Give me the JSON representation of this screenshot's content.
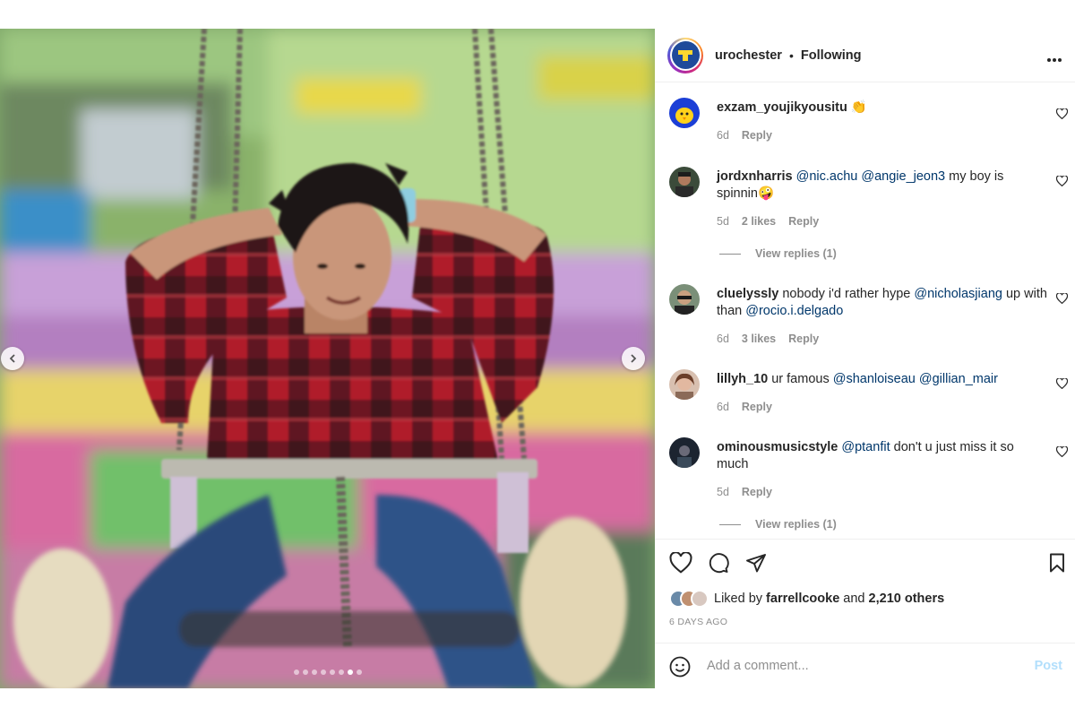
{
  "media": {
    "dots_total": 8,
    "dots_active_index": 6
  },
  "header": {
    "username": "urochester",
    "separator": "•",
    "following": "Following",
    "more_icon": "more-horizontal-icon",
    "logo_text": "#meliora"
  },
  "comments": [
    {
      "user": "exzam_youjikyousitu",
      "parts": [
        {
          "t": "👏",
          "m": false
        }
      ],
      "time": "6d",
      "likes": "",
      "reply": "Reply",
      "view_replies": ""
    },
    {
      "user": "jordxnharris",
      "parts": [
        {
          "t": "@nic.achu",
          "m": true
        },
        {
          "t": " ",
          "m": false
        },
        {
          "t": "@angie_jeon3",
          "m": true
        },
        {
          "t": " my boy is spinnin🤪",
          "m": false
        }
      ],
      "time": "5d",
      "likes": "2 likes",
      "reply": "Reply",
      "view_replies": "View replies (1)"
    },
    {
      "user": "cluelyssly",
      "parts": [
        {
          "t": "nobody i'd rather hype ",
          "m": false
        },
        {
          "t": "@nicholasjiang",
          "m": true
        },
        {
          "t": " up with than ",
          "m": false
        },
        {
          "t": "@rocio.i.delgado",
          "m": true
        }
      ],
      "time": "6d",
      "likes": "3 likes",
      "reply": "Reply",
      "view_replies": ""
    },
    {
      "user": "lillyh_10",
      "parts": [
        {
          "t": "ur famous ",
          "m": false
        },
        {
          "t": "@shanloiseau",
          "m": true
        },
        {
          "t": " ",
          "m": false
        },
        {
          "t": "@gillian_mair",
          "m": true
        }
      ],
      "time": "6d",
      "likes": "",
      "reply": "Reply",
      "view_replies": ""
    },
    {
      "user": "ominousmusicstyle",
      "parts": [
        {
          "t": "@ptanfit",
          "m": true
        },
        {
          "t": " don't u just miss it so much",
          "m": false
        }
      ],
      "time": "5d",
      "likes": "",
      "reply": "Reply",
      "view_replies": "View replies (1)"
    }
  ],
  "actions": {
    "liked_by_prefix": "Liked by",
    "liked_by_user": "farrellcooke",
    "liked_by_and": "and",
    "liked_by_others": "2,210 others",
    "time_ago": "6 DAYS AGO"
  },
  "add_comment": {
    "placeholder": "Add a comment...",
    "post_label": "Post"
  },
  "colors": {
    "mention": "#00376b",
    "muted": "#8e8e8e",
    "post_disabled": "#b2dffc"
  }
}
